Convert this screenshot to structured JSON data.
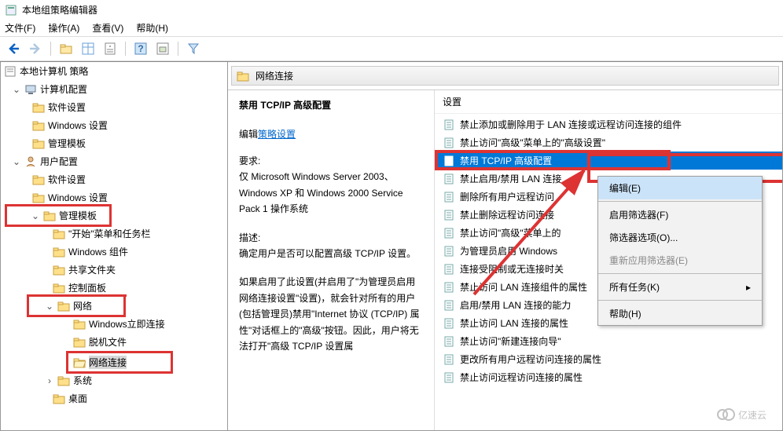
{
  "titlebar": {
    "title": "本地组策略编辑器"
  },
  "menubar": {
    "file": "文件(F)",
    "action": "操作(A)",
    "view": "查看(V)",
    "help": "帮助(H)"
  },
  "tree": {
    "root": "本地计算机 策略",
    "computer": "计算机配置",
    "software1": "软件设置",
    "windows1": "Windows 设置",
    "admin1": "管理模板",
    "user": "用户配置",
    "software2": "软件设置",
    "windows2": "Windows 设置",
    "admin2": "管理模板",
    "startmenu": "\"开始\"菜单和任务栏",
    "wincomp": "Windows 组件",
    "shared": "共享文件夹",
    "ctrlpanel": "控制面板",
    "network": "网络",
    "winconnect": "Windows立即连接",
    "offline": "脱机文件",
    "netconn": "网络连接",
    "system": "系统",
    "desktop": "桌面"
  },
  "header": {
    "title": "网络连接",
    "col": "设置"
  },
  "leftcol": {
    "title": "禁用 TCP/IP 高级配置",
    "editlabel": "编辑",
    "editlink": "策略设置",
    "req_head": "要求:",
    "req_body": "仅 Microsoft Windows Server 2003、Windows XP 和 Windows 2000 Service Pack 1 操作系统",
    "desc_head": "描述:",
    "desc_body": "确定用户是否可以配置高级 TCP/IP 设置。",
    "para2": "如果启用了此设置(并启用了\"为管理员启用网络连接设置\"设置)，就会针对所有的用户(包括管理员)禁用\"Internet 协议 (TCP/IP) 属性\"对话框上的\"高级\"按钮。因此，用户将无法打开\"高级 TCP/IP 设置属"
  },
  "settings": [
    "禁止添加或删除用于 LAN 连接或远程访问连接的组件",
    "禁止访问\"高级\"菜单上的\"高级设置\"",
    "禁用 TCP/IP 高级配置",
    "禁止启用/禁用 LAN 连接",
    "删除所有用户远程访问",
    "禁止删除远程访问连接",
    "禁止访问\"高级\"菜单上的",
    "为管理员启用 Windows",
    "连接受阻制或无连接时关",
    "禁止访问 LAN 连接组件的属性",
    "启用/禁用 LAN 连接的能力",
    "禁止访问 LAN 连接的属性",
    "禁止访问\"新建连接向导\"",
    "更改所有用户远程访问连接的属性",
    "禁止访问远程访问连接的属性"
  ],
  "contextmenu": {
    "edit": "编辑(E)",
    "filter_on": "启用筛选器(F)",
    "filter_opt": "筛选器选项(O)...",
    "filter_re": "重新应用筛选器(E)",
    "tasks": "所有任务(K)",
    "help": "帮助(H)"
  },
  "watermark": "亿速云"
}
